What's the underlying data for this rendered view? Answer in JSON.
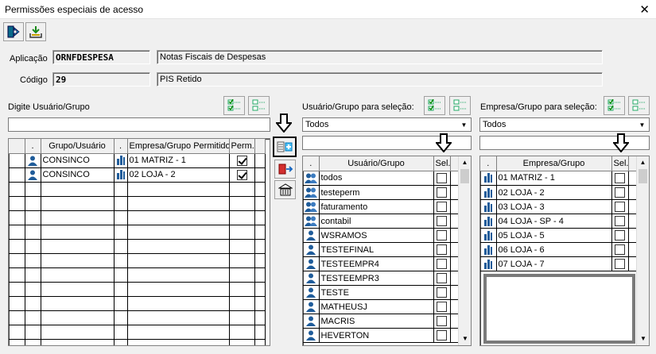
{
  "window": {
    "title": "Permissões especiais de acesso",
    "close": "✕"
  },
  "header": {
    "aplicacao_label": "Aplicação",
    "aplicacao_code": "ORNFDESPESA",
    "aplicacao_desc": "Notas Fiscais de Despesas",
    "codigo_label": "Código",
    "codigo_value": "29",
    "codigo_desc": "PIS Retido"
  },
  "left": {
    "label": "Digite Usuário/Grupo",
    "search_value": "",
    "columns": [
      ".",
      "Grupo/Usuário",
      ".",
      "Empresa/Grupo Permitido",
      "Perm."
    ],
    "rows": [
      {
        "user": "CONSINCO",
        "company": "01 MATRIZ - 1",
        "perm": true
      },
      {
        "user": "CONSINCO",
        "company": "02 LOJA - 2",
        "perm": true
      }
    ]
  },
  "middle": {
    "label": "Usuário/Grupo para seleção:",
    "combo_value": "Todos",
    "filter_value": "",
    "columns": [
      ".",
      "Usuário/Grupo",
      "Sel."
    ],
    "rows": [
      {
        "name": "todos",
        "type": "group"
      },
      {
        "name": "testeperm",
        "type": "group"
      },
      {
        "name": "faturamento",
        "type": "group"
      },
      {
        "name": "contabil",
        "type": "group"
      },
      {
        "name": "WSRAMOS",
        "type": "user"
      },
      {
        "name": "TESTEFINAL",
        "type": "user"
      },
      {
        "name": "TESTEEMPR4",
        "type": "user"
      },
      {
        "name": "TESTEEMPR3",
        "type": "user"
      },
      {
        "name": "TESTE",
        "type": "user"
      },
      {
        "name": "MATHEUSJ",
        "type": "user"
      },
      {
        "name": "MACRIS",
        "type": "user"
      },
      {
        "name": "HEVERTON",
        "type": "user"
      }
    ]
  },
  "right": {
    "label": "Empresa/Grupo para seleção:",
    "combo_value": "Todos",
    "filter_value": "",
    "columns": [
      ".",
      "Empresa/Grupo",
      "Sel."
    ],
    "rows": [
      {
        "name": "01 MATRIZ - 1"
      },
      {
        "name": "02 LOJA - 2"
      },
      {
        "name": "03 LOJA - 3"
      },
      {
        "name": "04 LOJA - SP - 4"
      },
      {
        "name": "05 LOJA - 5"
      },
      {
        "name": "06 LOJA - 6"
      },
      {
        "name": "07 LOJA - 7"
      }
    ]
  },
  "icons": {
    "exit": "exit-door-icon",
    "save": "save-tray-icon",
    "check_all": "check-all-icon",
    "uncheck_all": "uncheck-all-icon",
    "add_permission": "add-permission-icon",
    "remove_permission": "remove-permission-icon",
    "company": "building-icon",
    "user": "user-icon",
    "group": "group-icon"
  }
}
